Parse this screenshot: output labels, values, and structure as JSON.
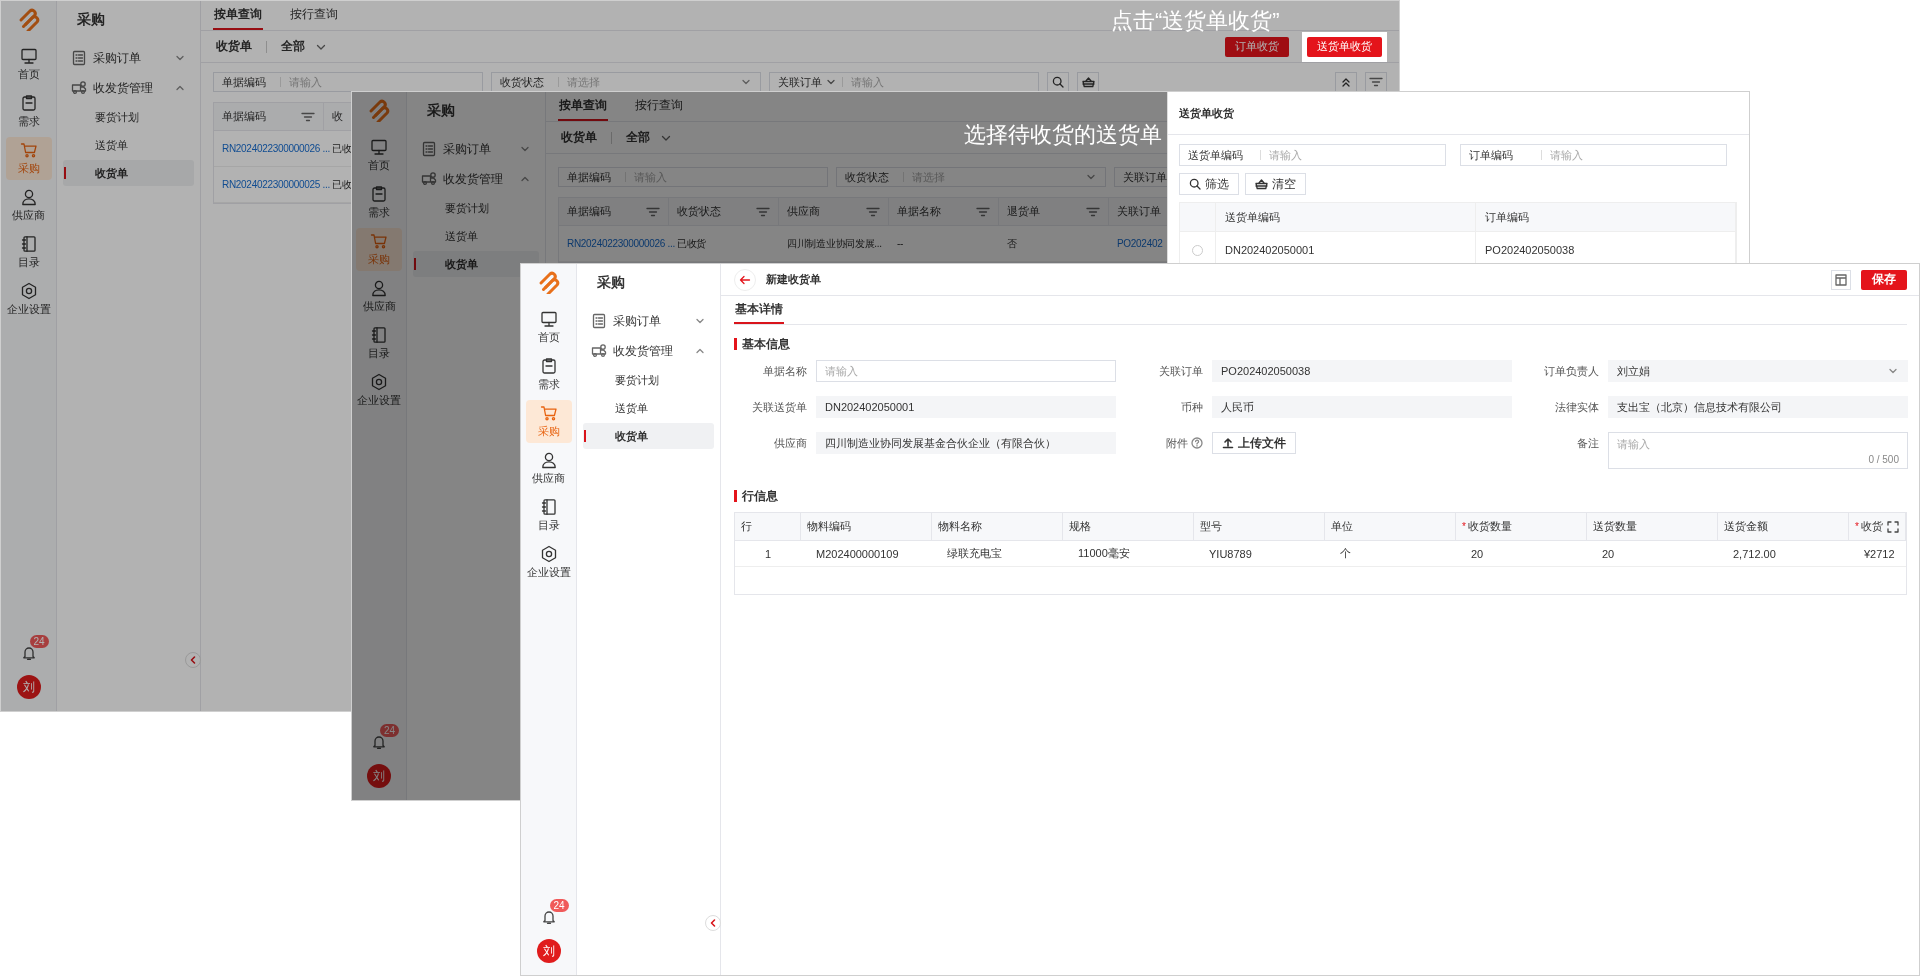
{
  "windows": [
    {
      "kind": "list",
      "dimmed": true,
      "rail": {
        "items": [
          {
            "label": "首页",
            "selected": false
          },
          {
            "label": "需求",
            "selected": false
          },
          {
            "label": "采购",
            "selected": true
          },
          {
            "label": "供应商",
            "selected": false
          },
          {
            "label": "目录",
            "selected": false
          },
          {
            "label": "企业设置",
            "selected": false
          }
        ],
        "badge": "24",
        "avatar": "刘"
      },
      "menu": {
        "title": "采购",
        "groups": [
          {
            "label": "采购订单",
            "expanded": false
          },
          {
            "label": "收发货管理",
            "expanded": true,
            "children": [
              {
                "label": "要货计划",
                "selected": false
              },
              {
                "label": "送货单",
                "selected": false
              },
              {
                "label": "收货单",
                "selected": true
              }
            ]
          }
        ]
      },
      "tabs": [
        {
          "label": "按单查询",
          "selected": true
        },
        {
          "label": "按行查询",
          "selected": false
        }
      ],
      "view": "收货单",
      "scope": "全部",
      "caption": "点击“送货单收货”",
      "collapsible": true,
      "buttons": [
        {
          "label": "订单收货",
          "highlighted": false
        },
        {
          "label": "送货单收货",
          "highlighted": true
        }
      ],
      "filters": [
        {
          "label": "单据编码",
          "kind": "input",
          "placeholder": "请输入"
        },
        {
          "label": "收货状态",
          "kind": "select",
          "placeholder": "请选择"
        },
        {
          "label": "关联订单",
          "kind": "combo",
          "placeholder": "请输入"
        }
      ],
      "table": {
        "columns": [
          {
            "label": "单据编码",
            "filter": true
          },
          {
            "label": "收",
            "filter": false
          }
        ],
        "rows": [
          [
            {
              "text": "RN2024022300000026 ...",
              "kind": "link"
            },
            {
              "text": "已收"
            }
          ],
          [
            {
              "text": "RN2024022300000025 ...",
              "kind": "link"
            },
            {
              "text": "已收"
            }
          ]
        ]
      }
    },
    {
      "kind": "list",
      "dimmed": true,
      "rail": {
        "items": [
          {
            "label": "首页",
            "selected": false
          },
          {
            "label": "需求",
            "selected": false
          },
          {
            "label": "采购",
            "selected": true
          },
          {
            "label": "供应商",
            "selected": false
          },
          {
            "label": "目录",
            "selected": false
          },
          {
            "label": "企业设置",
            "selected": false
          }
        ],
        "badge": "24",
        "avatar": "刘"
      },
      "menu": {
        "title": "采购",
        "groups": [
          {
            "label": "采购订单",
            "expanded": false
          },
          {
            "label": "收发货管理",
            "expanded": true,
            "children": [
              {
                "label": "要货计划",
                "selected": false
              },
              {
                "label": "送货单",
                "selected": false
              },
              {
                "label": "收货单",
                "selected": true
              }
            ]
          }
        ]
      },
      "tabs": [
        {
          "label": "按单查询",
          "selected": true
        },
        {
          "label": "按行查询",
          "selected": false
        }
      ],
      "view": "收货单",
      "scope": "全部",
      "caption": "选择待收货的送货单",
      "filters": [
        {
          "label": "单据编码",
          "kind": "input",
          "placeholder": "请输入"
        },
        {
          "label": "收货状态",
          "kind": "select",
          "placeholder": "请选择"
        },
        {
          "label": "关联订单",
          "kind": "input"
        }
      ],
      "table": {
        "columns": [
          {
            "label": "单据编码",
            "filter": true
          },
          {
            "label": "收货状态",
            "filter": true
          },
          {
            "label": "供应商",
            "filter": true
          },
          {
            "label": "单据名称",
            "filter": true
          },
          {
            "label": "退货单",
            "filter": true
          },
          {
            "label": "关联订单",
            "filter": false
          }
        ],
        "rows": [
          [
            {
              "text": "RN2024022300000026 ...",
              "kind": "link"
            },
            {
              "text": "已收货"
            },
            {
              "text": "四川制造业协同发展..."
            },
            {
              "text": "--"
            },
            {
              "text": "否"
            },
            {
              "text": "PO202402",
              "kind": "link"
            }
          ]
        ]
      },
      "dialog": {
        "title": "送货单收货",
        "filters": [
          {
            "label": "送货单编码",
            "kind": "input",
            "placeholder": "请输入"
          },
          {
            "label": "订单编码",
            "kind": "input",
            "placeholder": "请输入"
          }
        ],
        "actions": [
          {
            "label": "筛选",
            "kind": "search"
          },
          {
            "label": "清空",
            "kind": "clear"
          }
        ],
        "table": {
          "columns": [
            {
              "label": "送货单编码"
            },
            {
              "label": "订单编码"
            }
          ],
          "rows": [
            {
              "selected": false,
              "cells": [
                "DN202402050001",
                "PO202402050038"
              ]
            }
          ]
        }
      }
    },
    {
      "kind": "form",
      "rail": {
        "items": [
          {
            "label": "首页",
            "selected": false
          },
          {
            "label": "需求",
            "selected": false
          },
          {
            "label": "采购",
            "selected": true
          },
          {
            "label": "供应商",
            "selected": false
          },
          {
            "label": "目录",
            "selected": false
          },
          {
            "label": "企业设置",
            "selected": false
          }
        ],
        "badge": "24",
        "avatar": "刘"
      },
      "menu": {
        "title": "采购",
        "groups": [
          {
            "label": "采购订单",
            "expanded": false
          },
          {
            "label": "收发货管理",
            "expanded": true,
            "children": [
              {
                "label": "要货计划",
                "selected": false
              },
              {
                "label": "送货单",
                "selected": false
              },
              {
                "label": "收货单",
                "selected": true
              }
            ]
          }
        ]
      },
      "collapsible": true,
      "title": "新建收货单",
      "save": "保存",
      "tabs": [
        {
          "label": "基本详情",
          "selected": true
        }
      ],
      "sections": [
        {
          "kind": "form",
          "title": "基本信息",
          "fields": [
            {
              "label": "单据名称",
              "kind": "input",
              "placeholder": "请输入"
            },
            {
              "label": "关联订单",
              "kind": "readonly",
              "value": "PO202402050038"
            },
            {
              "label": "订单负责人",
              "kind": "select",
              "value": "刘立娟"
            },
            {
              "label": "关联送货单",
              "kind": "readonly",
              "value": "DN202402050001"
            },
            {
              "label": "币种",
              "kind": "readonly",
              "value": "人民币"
            },
            {
              "label": "法律实体",
              "kind": "readonly",
              "value": "支出宝（北京）信息技术有限公司"
            },
            {
              "label": "供应商",
              "kind": "readonly",
              "value": "四川制造业协同发展基金合伙企业（有限合伙）"
            },
            {
              "label": "附件",
              "kind": "upload",
              "help": true,
              "button": "上传文件"
            },
            {
              "label": "备注",
              "kind": "textarea",
              "placeholder": "请输入",
              "counter": "0 / 500"
            }
          ]
        },
        {
          "kind": "table",
          "title": "行信息",
          "table": {
            "columns": [
              {
                "label": "行"
              },
              {
                "label": "物料编码"
              },
              {
                "label": "物料名称"
              },
              {
                "label": "规格"
              },
              {
                "label": "型号"
              },
              {
                "label": "单位"
              },
              {
                "label": "收货数量",
                "required_mark": "*"
              },
              {
                "label": "送货数量"
              },
              {
                "label": "送货金额"
              },
              {
                "label": "收货",
                "required_mark": "*"
              }
            ],
            "rows": [
              [
                "1",
                "M202400000109",
                "绿联充电宝",
                "11000毫安",
                "YIU8789",
                "个",
                "20",
                "20",
                "2,712.00",
                "¥2712"
              ]
            ]
          }
        }
      ]
    }
  ]
}
